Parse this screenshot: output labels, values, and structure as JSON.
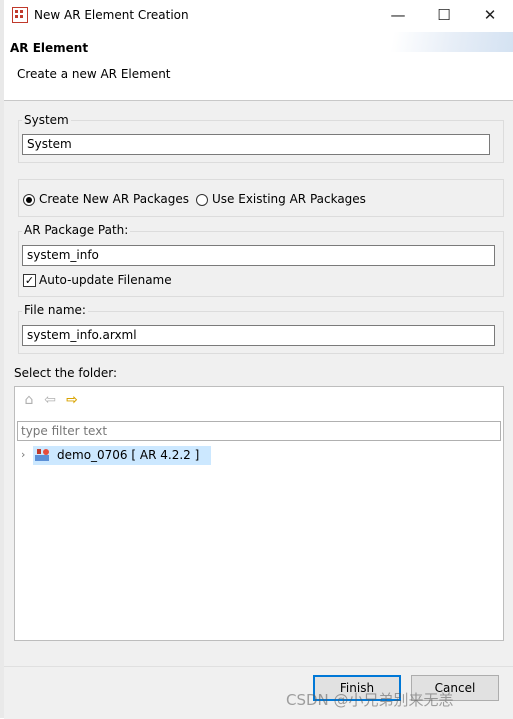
{
  "window": {
    "title": "New AR Element Creation",
    "minimize_glyph": "—",
    "maximize_glyph": "☐",
    "close_glyph": "✕"
  },
  "header": {
    "title": "AR Element",
    "subtitle": "Create a new AR Element"
  },
  "system_group": {
    "label": "System",
    "value": "System"
  },
  "package_options": {
    "create_new_label": "Create New AR Packages",
    "use_existing_label": "Use Existing AR Packages",
    "selected": "create_new"
  },
  "package_path": {
    "label": "AR Package Path:",
    "value": "system_info",
    "auto_update_label": "Auto-update Filename",
    "auto_update_checked": true
  },
  "file_name": {
    "label": "File name:",
    "value": "system_info.arxml"
  },
  "folder": {
    "label": "Select the folder:",
    "filter_placeholder": "type filter text",
    "toolbar_icons": [
      "home-icon",
      "back-arrow-icon",
      "forward-arrow-icon"
    ],
    "tree_items": [
      {
        "label": "demo_0706 [ AR 4.2.2 ]",
        "icon": "ar-project-icon",
        "expanded": false,
        "selected": true
      }
    ]
  },
  "footer": {
    "finish_label": "Finish",
    "cancel_label": "Cancel"
  },
  "watermark": "CSDN @小兄弟别来无恙",
  "colors": {
    "accent": "#0078d7",
    "selection": "#cce8ff",
    "dialog_bg": "#f0f0f0",
    "app_icon": "#c0392b"
  }
}
